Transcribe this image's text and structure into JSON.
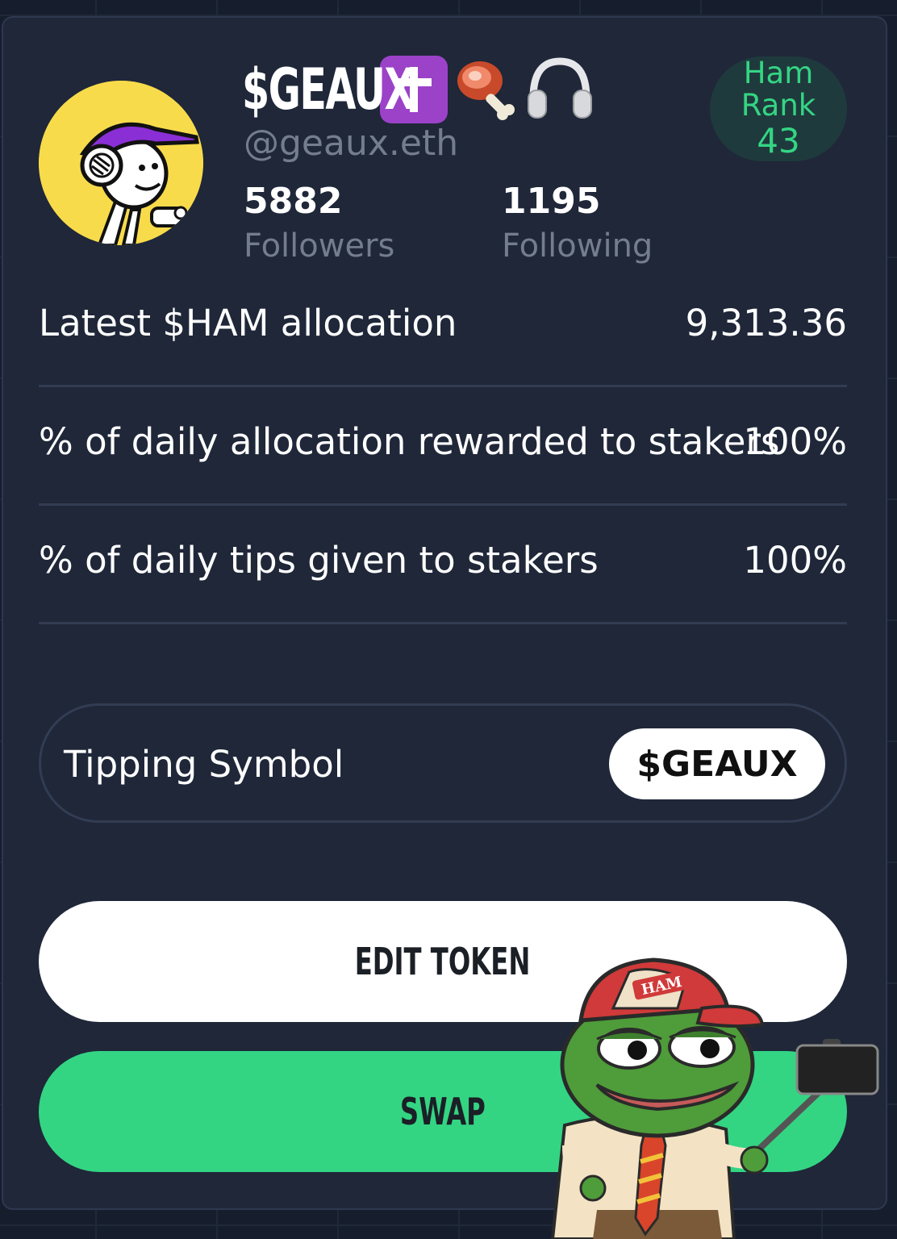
{
  "profile": {
    "name": "$GEAUX",
    "handle": "@geaux.eth",
    "followers_count": "5882",
    "followers_label": "Followers",
    "following_count": "1195",
    "following_label": "Following",
    "emoji_icons": [
      "latin-cross-icon",
      "meat-on-bone-icon",
      "headphones-icon"
    ],
    "rank": {
      "line1": "Ham",
      "line2": "Rank",
      "value": "43"
    }
  },
  "stats": [
    {
      "label": "Latest $HAM allocation",
      "value": "9,313.36"
    },
    {
      "label": "% of daily allocation rewarded to stakers",
      "value": "100%"
    },
    {
      "label": "% of daily tips given to stakers",
      "value": "100%"
    }
  ],
  "tipping": {
    "label": "Tipping Symbol",
    "symbol": "$GEAUX"
  },
  "buttons": {
    "edit": "EDIT TOKEN",
    "swap": "SWAP"
  },
  "sticker": {
    "hat_text": "HAM"
  },
  "colors": {
    "background": "#161e2e",
    "card": "#1f2739",
    "accent_green": "#33d583",
    "muted_text": "#747d8d",
    "badge_purple": "#9b42c8"
  }
}
